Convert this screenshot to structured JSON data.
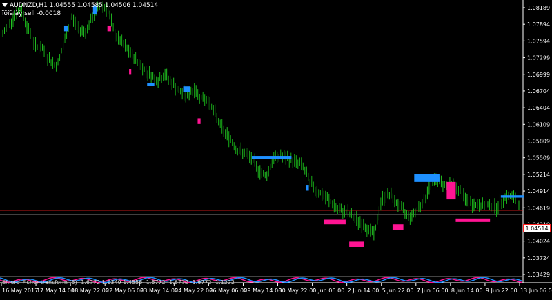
{
  "header": {
    "symbol_line": "AUDNZD,H1  1.04555 1.04585 1.04506 1.04514",
    "signal_line": "ïõîäíàÿ sell -0.0018"
  },
  "indicator": {
    "label": "Ehlers' Fisher transform (5) -1.6772 1.0349 1.4556 -1.6772 -1.6772 -1.6772 -1.1222"
  },
  "current_price": "1.04514",
  "colors": {
    "up_candle": "#22c322",
    "down_candle": "#18b018",
    "bull_block": "#1e90ff",
    "bear_block": "#ff1493",
    "price_line": "#ff2020",
    "axis": "#ffffff",
    "indicator_a": "#ff1493",
    "indicator_b": "#1e90ff"
  },
  "chart_data": {
    "type": "candlestick",
    "symbol": "AUDNZD",
    "timeframe": "H1",
    "ohlc_current": {
      "open": 1.04555,
      "high": 1.04585,
      "low": 1.04506,
      "close": 1.04514
    },
    "y_ticks": [
      "1.08189",
      "1.07894",
      "1.07594",
      "1.07299",
      "1.06999",
      "1.06704",
      "1.06404",
      "1.06109",
      "1.05809",
      "1.05509",
      "1.05214",
      "1.04914",
      "1.04619",
      "1.04319",
      "1.04024",
      "1.03724",
      "1.03429"
    ],
    "y_range": [
      1.0343,
      1.0819
    ],
    "x_ticks": [
      "16 May 2017",
      "17 May 14:00",
      "18 May 22:00",
      "22 May 06:00",
      "23 May 14:00",
      "24 May 22:00",
      "26 May 06:00",
      "29 May 14:00",
      "30 May 22:00",
      "1 Jun 06:00",
      "2 Jun 14:00",
      "5 Jun 22:00",
      "7 Jun 06:00",
      "8 Jun 14:00",
      "9 Jun 22:00",
      "13 Jun 06:00"
    ],
    "path_points": [
      [
        0,
        1.076
      ],
      [
        3,
        1.079
      ],
      [
        5,
        1.0805
      ],
      [
        7,
        1.077
      ],
      [
        9,
        1.074
      ],
      [
        11,
        1.0735
      ],
      [
        13,
        1.0715
      ],
      [
        15,
        1.0705
      ],
      [
        17,
        1.0745
      ],
      [
        19,
        1.079
      ],
      [
        21,
        1.077
      ],
      [
        23,
        1.0765
      ],
      [
        25,
        1.079
      ],
      [
        27,
        1.081
      ],
      [
        29,
        1.0805
      ],
      [
        31,
        1.076
      ],
      [
        33,
        1.0745
      ],
      [
        35,
        1.073
      ],
      [
        37,
        1.0715
      ],
      [
        39,
        1.07
      ],
      [
        41,
        1.069
      ],
      [
        43,
        1.068
      ],
      [
        45,
        1.069
      ],
      [
        47,
        1.0675
      ],
      [
        49,
        1.066
      ],
      [
        51,
        1.0655
      ],
      [
        53,
        1.0665
      ],
      [
        55,
        1.065
      ],
      [
        57,
        1.0645
      ],
      [
        59,
        1.062
      ],
      [
        61,
        1.0595
      ],
      [
        63,
        1.058
      ],
      [
        65,
        1.056
      ],
      [
        67,
        1.0555
      ],
      [
        69,
        1.0545
      ],
      [
        71,
        1.0525
      ],
      [
        73,
        1.0515
      ],
      [
        75,
        1.0545
      ],
      [
        77,
        1.055
      ],
      [
        79,
        1.0545
      ],
      [
        81,
        1.054
      ],
      [
        83,
        1.0535
      ],
      [
        85,
        1.0505
      ],
      [
        87,
        1.049
      ],
      [
        89,
        1.048
      ],
      [
        91,
        1.047
      ],
      [
        93,
        1.0455
      ],
      [
        95,
        1.0455
      ],
      [
        97,
        1.0445
      ],
      [
        99,
        1.0435
      ],
      [
        101,
        1.0425
      ],
      [
        103,
        1.0415
      ],
      [
        105,
        1.0475
      ],
      [
        107,
        1.0485
      ],
      [
        109,
        1.047
      ],
      [
        111,
        1.0455
      ],
      [
        113,
        1.0445
      ],
      [
        115,
        1.046
      ],
      [
        117,
        1.0475
      ],
      [
        119,
        1.051
      ],
      [
        121,
        1.0505
      ],
      [
        123,
        1.05
      ],
      [
        125,
        1.05
      ],
      [
        127,
        1.0485
      ],
      [
        129,
        1.047
      ],
      [
        131,
        1.0465
      ],
      [
        133,
        1.0465
      ],
      [
        135,
        1.0465
      ],
      [
        137,
        1.046
      ],
      [
        139,
        1.048
      ],
      [
        141,
        1.048
      ],
      [
        143,
        1.047
      ]
    ],
    "path_x_max": 143,
    "blocks": [
      {
        "color": "bull",
        "x0": 17,
        "x1": 18,
        "y0": 1.0775,
        "y1": 1.0765
      },
      {
        "color": "bull",
        "x0": 25,
        "x1": 26,
        "y0": 1.081,
        "y1": 1.0795
      },
      {
        "color": "bear",
        "x0": 29,
        "x1": 30,
        "y0": 1.0775,
        "y1": 1.0765
      },
      {
        "color": "bear",
        "x0": 35,
        "x1": 35.6,
        "y0": 1.07,
        "y1": 1.069
      },
      {
        "color": "bull",
        "x0": 40,
        "x1": 42,
        "y0": 1.0675,
        "y1": 1.0672
      },
      {
        "color": "bull",
        "x0": 50,
        "x1": 52,
        "y0": 1.067,
        "y1": 1.066
      },
      {
        "color": "bear",
        "x0": 54,
        "x1": 54.8,
        "y0": 1.0615,
        "y1": 1.0605
      },
      {
        "color": "bull",
        "x0": 69,
        "x1": 80,
        "y0": 1.055,
        "y1": 1.0545
      },
      {
        "color": "bull",
        "x0": 84,
        "x1": 84.8,
        "y0": 1.05,
        "y1": 1.049
      },
      {
        "color": "bear",
        "x0": 89,
        "x1": 95,
        "y0": 1.044,
        "y1": 1.0432
      },
      {
        "color": "bear",
        "x0": 96,
        "x1": 100,
        "y0": 1.0402,
        "y1": 1.0393
      },
      {
        "color": "bear",
        "x0": 108,
        "x1": 111,
        "y0": 1.0432,
        "y1": 1.0422
      },
      {
        "color": "bull",
        "x0": 114,
        "x1": 121,
        "y0": 1.0518,
        "y1": 1.0505
      },
      {
        "color": "bear",
        "x0": 123,
        "x1": 125.5,
        "y0": 1.0505,
        "y1": 1.0475
      },
      {
        "color": "bear",
        "x0": 125.5,
        "x1": 135,
        "y0": 1.0442,
        "y1": 1.0436
      },
      {
        "color": "bull",
        "x0": 138,
        "x1": 144.5,
        "y0": 1.0482,
        "y1": 1.0478
      }
    ]
  }
}
